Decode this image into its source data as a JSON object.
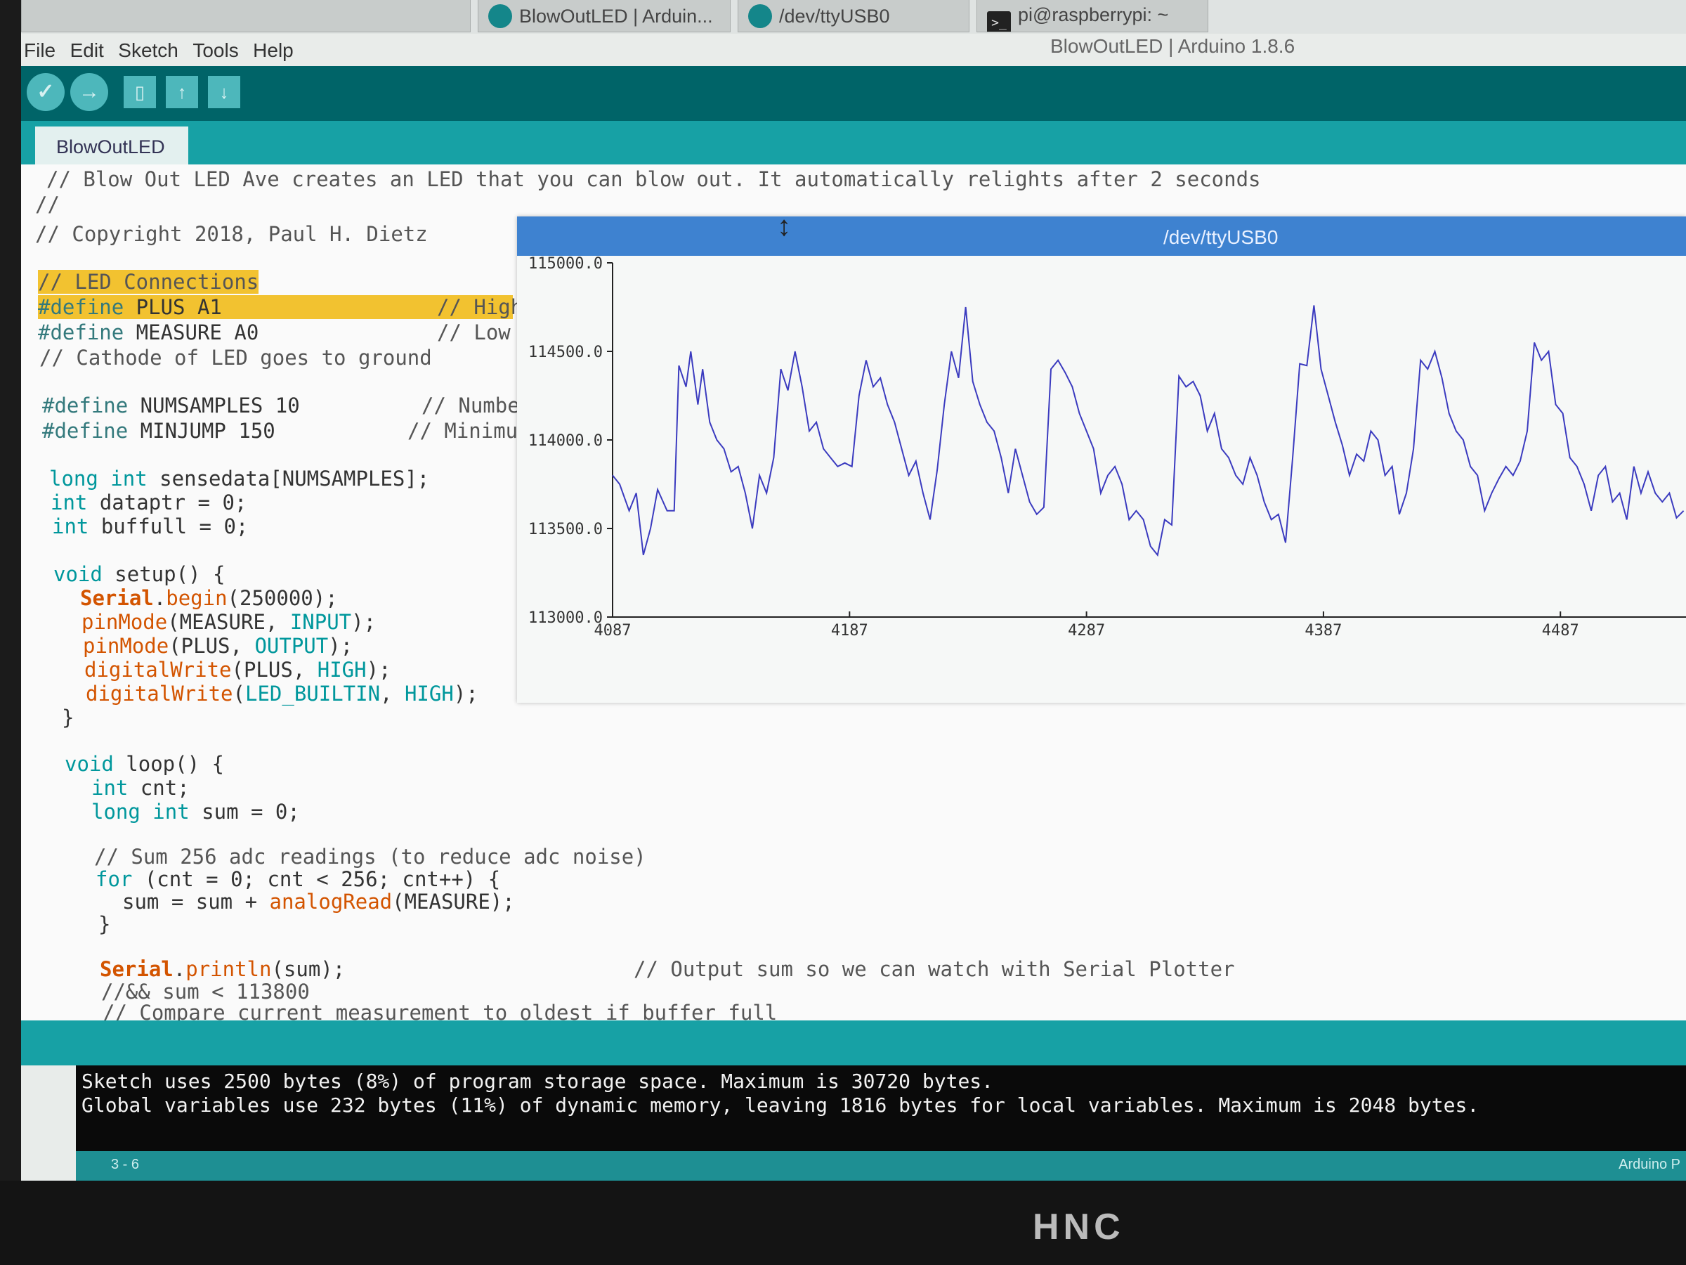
{
  "taskbar": {
    "tasks": [
      "BlowOutLED | Arduin...",
      "/dev/ttyUSB0",
      "pi@raspberrypi: ~"
    ]
  },
  "menu": [
    "File",
    "Edit",
    "Sketch",
    "Tools",
    "Help"
  ],
  "window_title": "BlowOutLED | Arduino 1.8.6",
  "toolbar": {
    "icons": [
      "verify-icon",
      "upload-icon",
      "new-icon",
      "open-icon",
      "save-icon"
    ]
  },
  "tab": {
    "label": "BlowOutLED"
  },
  "code": {
    "l1": "// Blow Out LED Ave creates an LED that you can blow out. It automatically relights after 2 seconds",
    "l2": "//",
    "l3": "// Copyright 2018, Paul H. Dietz",
    "l4": "// LED Connections",
    "l5a": "#define",
    "l5b": " PLUS A1",
    "l5c": "// High",
    "l6a": "#define",
    "l6b": " MEASURE A0",
    "l6c": "// Low",
    "l7": "// Cathode of LED goes to ground",
    "l8a": "#define",
    "l8b": " NUMSAMPLES 10",
    "l8c": "// Numbe",
    "l9a": "#define",
    "l9b": " MINJUMP 150",
    "l9c": "// Minimu",
    "l10a": "long int",
    "l10b": " sensedata[NUMSAMPLES];",
    "l11a": "int",
    "l11b": " dataptr = 0;",
    "l12a": "int",
    "l12b": " buffull = 0;",
    "l13a": "void",
    "l13b": " setup() {",
    "l14a": "Serial",
    "l14b": ".",
    "l14c": "begin",
    "l14d": "(250000);",
    "l15a": "pinMode",
    "l15b": "(MEASURE, ",
    "l15c": "INPUT",
    "l15d": ");",
    "l16a": "pinMode",
    "l16b": "(PLUS, ",
    "l16c": "OUTPUT",
    "l16d": ");",
    "l17a": "digitalWrite",
    "l17b": "(PLUS, ",
    "l17c": "HIGH",
    "l17d": ");",
    "l18a": "digitalWrite",
    "l18b": "(",
    "l18c": "LED_BUILTIN",
    "l18d": ", ",
    "l18e": "HIGH",
    "l18f": ");",
    "l19": "}",
    "l20a": "void",
    "l20b": " loop() {",
    "l21a": "int",
    "l21b": " cnt;",
    "l22a": "long int",
    "l22b": " sum = 0;",
    "l23": "// Sum 256 adc readings (to reduce adc noise)",
    "l24a": "for",
    "l24b": " (cnt = 0; cnt < 256; cnt++) {",
    "l25a": "sum = sum + ",
    "l25b": "analogRead",
    "l25c": "(MEASURE);",
    "l26": "}",
    "l27a": "Serial",
    "l27b": ".",
    "l27c": "println",
    "l27d": "(sum);",
    "l27e": "// Output sum so we can watch with Serial Plotter",
    "l28": "//&& sum < 113800",
    "l29": "// Compare current measurement to oldest if buffer full"
  },
  "plotter": {
    "title": "/dev/ttyUSB0",
    "resize_icon": "resize-vertical-icon"
  },
  "chart_data": {
    "type": "line",
    "xlim": [
      4087,
      4540
    ],
    "ylim": [
      113000.0,
      115000.0
    ],
    "x_ticks": [
      "4087",
      "4187",
      "4287",
      "4387",
      "4487"
    ],
    "y_ticks": [
      "115000.0",
      "114500.0",
      "114000.0",
      "113500.0",
      "113000.0"
    ],
    "line_color": "#3b3bbf",
    "series": [
      {
        "x": [
          4087,
          4090,
          4094,
          4097,
          4100,
          4103,
          4106,
          4110,
          4113,
          4115,
          4118,
          4120,
          4123,
          4125,
          4128,
          4131,
          4134,
          4137,
          4140,
          4143,
          4146,
          4149,
          4152,
          4155,
          4158,
          4161,
          4164,
          4167,
          4170,
          4173,
          4176,
          4179,
          4182,
          4185,
          4188,
          4191,
          4194,
          4197,
          4200,
          4203,
          4206,
          4209,
          4212,
          4215,
          4218,
          4221,
          4224,
          4227,
          4230,
          4233,
          4236,
          4239,
          4242,
          4245,
          4248,
          4251,
          4254,
          4257,
          4260,
          4263,
          4266,
          4269,
          4272,
          4275,
          4278,
          4281,
          4284,
          4287,
          4290,
          4293,
          4296,
          4299,
          4302,
          4305,
          4308,
          4311,
          4314,
          4317,
          4320,
          4323,
          4326,
          4329,
          4332,
          4335,
          4338,
          4341,
          4344,
          4347,
          4350,
          4353,
          4356,
          4359,
          4362,
          4365,
          4368,
          4371,
          4374,
          4377,
          4380,
          4383,
          4386,
          4389,
          4392,
          4395,
          4398,
          4401,
          4404,
          4407,
          4410,
          4413,
          4416,
          4419,
          4422,
          4425,
          4428,
          4431,
          4434,
          4437,
          4440,
          4443,
          4446,
          4449,
          4452,
          4455,
          4458,
          4461,
          4464,
          4467,
          4470,
          4473,
          4476,
          4479,
          4482,
          4485,
          4488,
          4491,
          4494,
          4497,
          4500,
          4503,
          4506,
          4509,
          4512,
          4515,
          4518,
          4521,
          4524,
          4527,
          4530,
          4533,
          4536,
          4539
        ],
        "y": [
          113800,
          113750,
          113600,
          113700,
          113350,
          113500,
          113720,
          113600,
          113600,
          114420,
          114300,
          114500,
          114200,
          114400,
          114100,
          114000,
          113950,
          113820,
          113850,
          113700,
          113500,
          113800,
          113700,
          113900,
          114400,
          114280,
          114500,
          114300,
          114050,
          114100,
          113950,
          113900,
          113850,
          113870,
          113850,
          114250,
          114450,
          114300,
          114350,
          114200,
          114100,
          113950,
          113800,
          113880,
          113700,
          113550,
          113830,
          114200,
          114500,
          114350,
          114750,
          114330,
          114200,
          114100,
          114050,
          113900,
          113700,
          113950,
          113800,
          113650,
          113580,
          113620,
          114400,
          114450,
          114380,
          114300,
          114150,
          114050,
          113950,
          113700,
          113800,
          113850,
          113750,
          113550,
          113600,
          113550,
          113400,
          113350,
          113550,
          113520,
          114360,
          114300,
          114330,
          114250,
          114050,
          114150,
          113950,
          113900,
          113800,
          113750,
          113900,
          113800,
          113650,
          113550,
          113580,
          113420,
          113900,
          114430,
          114420,
          114760,
          114400,
          114250,
          114100,
          113970,
          113800,
          113920,
          113880,
          114050,
          114000,
          113800,
          113850,
          113580,
          113700,
          113950,
          114450,
          114400,
          114500,
          114350,
          114150,
          114050,
          114000,
          113850,
          113800,
          113600,
          113700,
          113780,
          113850,
          113800,
          113880,
          114050,
          114550,
          114450,
          114500,
          114200,
          114150,
          113900,
          113850,
          113750,
          113600,
          113800,
          113850,
          113650,
          113700,
          113550,
          113850,
          113700,
          113820,
          113700,
          113650,
          113700,
          113560,
          113600
        ]
      }
    ]
  },
  "console": {
    "line1": "Sketch uses 2500 bytes (8%) of program storage space. Maximum is 30720 bytes.",
    "line2": "Global variables use 232 bytes (11%) of dynamic memory, leaving 1816 bytes for local variables. Maximum is 2048 bytes."
  },
  "status": {
    "line_col": "3 - 6",
    "board": "Arduino P"
  },
  "bezel": {
    "brand": "HNC"
  }
}
